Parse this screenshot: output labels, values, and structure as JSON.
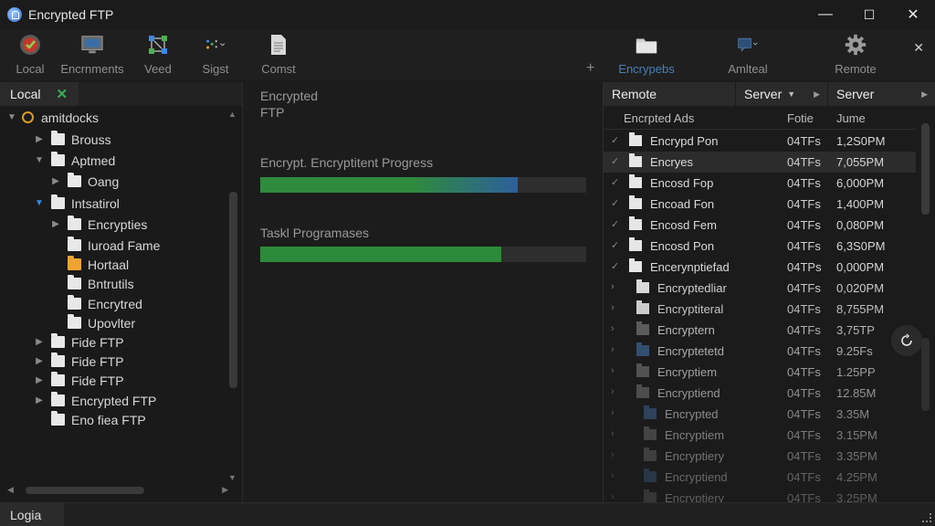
{
  "window": {
    "title": "Encrypted FTP",
    "minimize": "—",
    "maximize": "☐",
    "close": "✕"
  },
  "toolbar": {
    "items": [
      {
        "label": "Local",
        "icon": "local-shield-icon"
      },
      {
        "label": "Encrnments",
        "icon": "monitor-icon"
      },
      {
        "label": "Veed",
        "icon": "network-icon"
      },
      {
        "label": "Sigst",
        "icon": "dots-icon"
      },
      {
        "label": "Comst",
        "icon": "document-icon"
      },
      {
        "label": "Encrypebs",
        "icon": "folder-icon"
      },
      {
        "label": "Amlteal",
        "icon": "chat-icon"
      },
      {
        "label": "Remote",
        "icon": "gear-icon"
      }
    ],
    "plus": "+",
    "close": "✕"
  },
  "local": {
    "tab_label": "Local",
    "tab_close": "✕",
    "tree": [
      {
        "label": "amitdocks",
        "icon": "ring"
      },
      {
        "label": "Brouss"
      },
      {
        "label": "Aptmed"
      },
      {
        "label": "Oang"
      },
      {
        "label": "Intsatirol"
      },
      {
        "label": "Encrypties"
      },
      {
        "label": "Iuroad Fame"
      },
      {
        "label": "Hortaal",
        "icon": "orange-folder"
      },
      {
        "label": "Bntrutils"
      },
      {
        "label": "Encrytred"
      },
      {
        "label": "Upovlter"
      },
      {
        "label": "Fide FTP"
      },
      {
        "label": "Fide FTP"
      },
      {
        "label": "Fide FTP"
      },
      {
        "label": "Encrypted FTP"
      },
      {
        "label": "Eno fiea FTP"
      }
    ]
  },
  "middle": {
    "heading_line1": "Encrypted",
    "heading_line2": "FTP",
    "progress1_label": "Encrypt. Encryptitent Progress",
    "progress1_value": 0.79,
    "progress1_color_start": "#2f8a3e",
    "progress1_color_end": "#2d5f9c",
    "progress2_label": "Taskl Programases",
    "progress2_value": 0.74,
    "progress2_color": "#2d8a3a"
  },
  "remote": {
    "head_remote": "Remote",
    "head_server1": "Server",
    "head_server2": "Server",
    "col_name": "Encrpted Ads",
    "col_size": "Fotie",
    "col_time": "Jume",
    "rows": [
      {
        "name": "Encrypd Pon",
        "size": "04TFs",
        "time": "1,2S0PM"
      },
      {
        "name": "Encryes",
        "size": "04TFs",
        "time": "7,055PM"
      },
      {
        "name": "Encosd Fop",
        "size": "04TFs",
        "time": "6,000PM"
      },
      {
        "name": "Encoad Fon",
        "size": "04TFs",
        "time": "1,400PM"
      },
      {
        "name": "Encosd Fem",
        "size": "04TFs",
        "time": "0,080PM"
      },
      {
        "name": "Encosd Pon",
        "size": "04TFs",
        "time": "6,3S0PM"
      },
      {
        "name": "Encerynptiefad",
        "size": "04TPs",
        "time": "0,000PM"
      },
      {
        "name": "Encryptedliar",
        "size": "04TFs",
        "time": "0,020PM"
      },
      {
        "name": "Encryptiteral",
        "size": "04TFs",
        "time": "8,755PM"
      },
      {
        "name": "Encryptern",
        "size": "04TFs",
        "time": "3,75TP"
      },
      {
        "name": "Encryptetetd",
        "size": "04TFs",
        "time": "9.25Fs"
      },
      {
        "name": "Encryptiem",
        "size": "04TFs",
        "time": "1.25PP"
      },
      {
        "name": "Encryptiend",
        "size": "04TFs",
        "time": "12.85M"
      },
      {
        "name": "Encrypted",
        "size": "04TFs",
        "time": "3.35M"
      },
      {
        "name": "Encryptiem",
        "size": "04TFs",
        "time": "3.15PM"
      },
      {
        "name": "Encryptiery",
        "size": "04TFs",
        "time": "3.35PM"
      },
      {
        "name": "Encryptiend",
        "size": "04TFs",
        "time": "4.25PM"
      },
      {
        "name": "Encryptiery",
        "size": "04TFs",
        "time": "3.25PM"
      }
    ]
  },
  "status": {
    "tab_label": "Logia"
  }
}
